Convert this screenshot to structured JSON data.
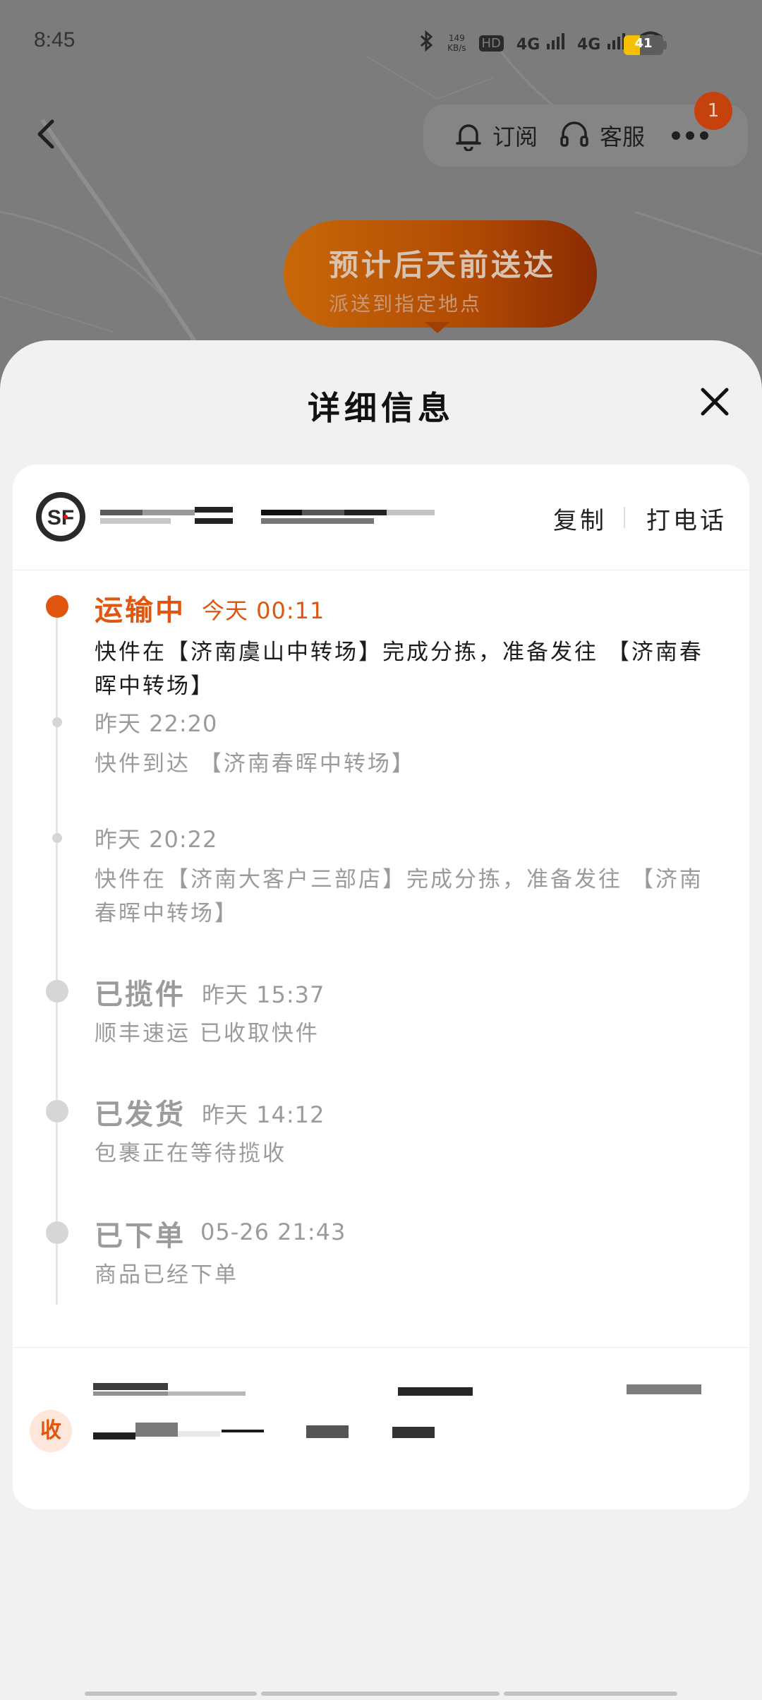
{
  "status_bar": {
    "time": "8:45",
    "speed_value": "149",
    "speed_unit": "KB/s",
    "hd_label": "HD",
    "net1": "4G",
    "net2": "4G",
    "battery_level": "41"
  },
  "top_bar": {
    "subscribe_label": "订阅",
    "service_label": "客服",
    "badge_count": "1"
  },
  "eta": {
    "title": "预计后天前送达",
    "subtitle": "派送到指定地点"
  },
  "sheet": {
    "title": "详细信息"
  },
  "tracking": {
    "carrier_logo_text": "SF",
    "copy_label": "复制",
    "call_label": "打电话"
  },
  "timeline": [
    {
      "status": "运输中",
      "time": "今天  00:11",
      "desc": "快件在【济南虞山中转场】完成分拣，准备发往 【济南春晖中转场】"
    },
    {
      "status": "",
      "time": "昨天  22:20",
      "desc": "快件到达 【济南春晖中转场】"
    },
    {
      "status": "",
      "time": "昨天  20:22",
      "desc": "快件在【济南大客户三部店】完成分拣，准备发往 【济南春晖中转场】"
    },
    {
      "status": "已揽件",
      "time": "昨天  15:37",
      "desc": "顺丰速运 已收取快件"
    },
    {
      "status": "已发货",
      "time": "昨天  14:12",
      "desc": "包裹正在等待揽收"
    },
    {
      "status": "已下单",
      "time": "05-26  21:43",
      "desc": "商品已经下单"
    }
  ],
  "receiver": {
    "badge": "收"
  },
  "colors": {
    "accent": "#e0560e",
    "eta_start": "#c86808",
    "eta_end": "#8a2a02",
    "map": "#7c7c7c"
  }
}
